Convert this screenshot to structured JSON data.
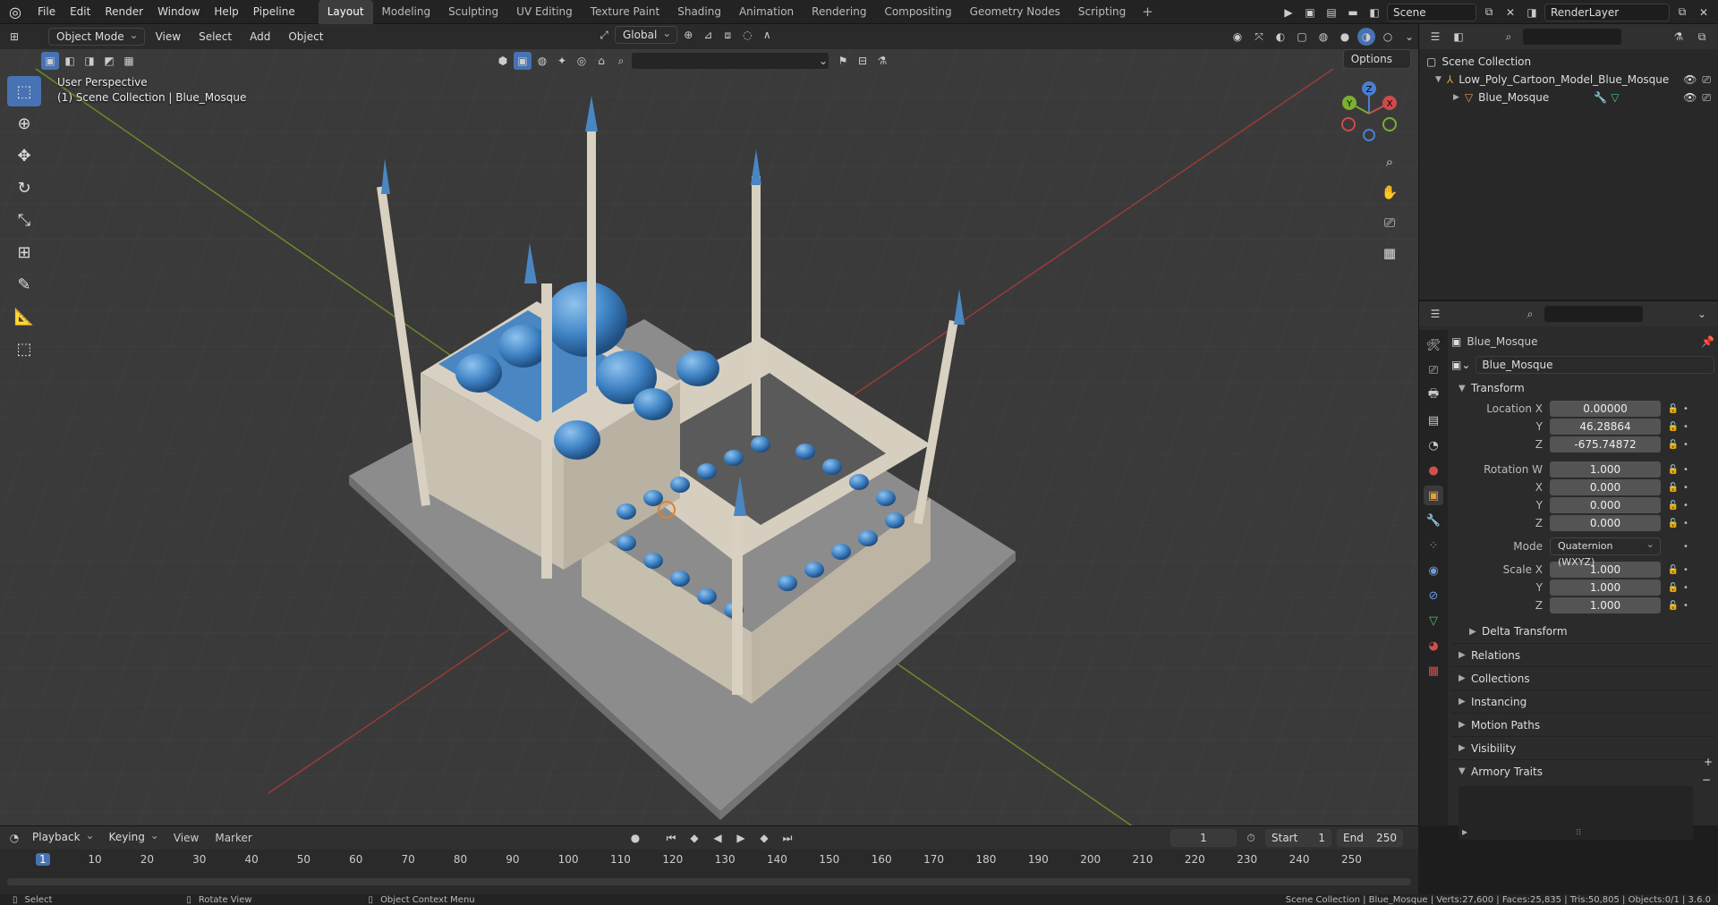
{
  "topbar": {
    "menus": [
      "File",
      "Edit",
      "Render",
      "Window",
      "Help",
      "Pipeline"
    ],
    "workspaces": [
      "Layout",
      "Modeling",
      "Sculpting",
      "UV Editing",
      "Texture Paint",
      "Shading",
      "Animation",
      "Rendering",
      "Compositing",
      "Geometry Nodes",
      "Scripting"
    ],
    "active_workspace": "Layout",
    "scene": "Scene",
    "render_layer": "RenderLayer"
  },
  "viewport": {
    "mode": "Object Mode",
    "menus": [
      "View",
      "Select",
      "Add",
      "Object"
    ],
    "orientation": "Global",
    "options_label": "Options",
    "perspective_label": "User Perspective",
    "collection_label": "(1) Scene Collection | Blue_Mosque",
    "gizmo": {
      "x": "X",
      "y": "Y",
      "z": "Z"
    }
  },
  "outliner": {
    "root": "Scene Collection",
    "items": [
      {
        "label": "Low_Poly_Cartoon_Model_Blue_Mosque"
      },
      {
        "label": "Blue_Mosque"
      }
    ]
  },
  "properties": {
    "object_name": "Blue_Mosque",
    "data_name": "Blue_Mosque",
    "transform_label": "Transform",
    "location": {
      "label": "Location X",
      "x": "0.00000",
      "y": "46.28864",
      "z": "-675.74872"
    },
    "rotation": {
      "label": "Rotation W",
      "w": "1.000",
      "x": "0.000",
      "y": "0.000",
      "z": "0.000"
    },
    "mode_label": "Mode",
    "mode_value": "Quaternion (WXYZ)",
    "scale": {
      "label": "Scale X",
      "x": "1.000",
      "y": "1.000",
      "z": "1.000"
    },
    "axis_labels": {
      "y": "Y",
      "z": "Z",
      "x": "X"
    },
    "panels": [
      "Delta Transform",
      "Relations",
      "Collections",
      "Instancing",
      "Motion Paths",
      "Visibility",
      "Armory Traits"
    ]
  },
  "timeline": {
    "menus": [
      "Playback",
      "Keying",
      "View",
      "Marker"
    ],
    "current_frame": "1",
    "start_label": "Start",
    "start": "1",
    "end_label": "End",
    "end": "250",
    "ticks": [
      "1",
      "10",
      "20",
      "30",
      "40",
      "50",
      "60",
      "70",
      "80",
      "90",
      "100",
      "110",
      "120",
      "130",
      "140",
      "150",
      "160",
      "170",
      "180",
      "190",
      "200",
      "210",
      "220",
      "230",
      "240",
      "250"
    ]
  },
  "statusbar": {
    "select": "Select",
    "rotate": "Rotate View",
    "context": "Object Context Menu",
    "stats": "Scene Collection | Blue_Mosque | Verts:27,600 | Faces:25,835 | Tris:50,805 | Objects:0/1 | 3.6.0"
  },
  "colors": {
    "accent": "#4772b3",
    "dome": "#3e82c4",
    "stone": "#d8d1c3"
  }
}
